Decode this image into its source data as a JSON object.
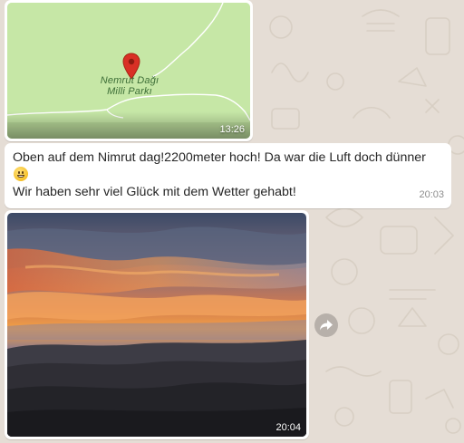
{
  "colors": {
    "chat_background": "#e5ddd5",
    "bubble": "#ffffff",
    "map_land": "#c6e7a6",
    "pin": "#d93025"
  },
  "location_message": {
    "place_name_line1": "Nemrut Dağı",
    "place_name_line2": "Milli Parkı",
    "time": "13:26",
    "icon": "map-pin-icon"
  },
  "text_message": {
    "line1": "Oben auf dem Nimrut dag!2200meter hoch! Da war die Luft doch dünner",
    "emoji": "grinning-face",
    "line2": "Wir haben sehr viel Glück mit dem Wetter gehabt!",
    "time": "20:03"
  },
  "image_message": {
    "time": "20:04",
    "subject": "sunset over mountains",
    "forward_icon": "forward-arrow-icon"
  }
}
